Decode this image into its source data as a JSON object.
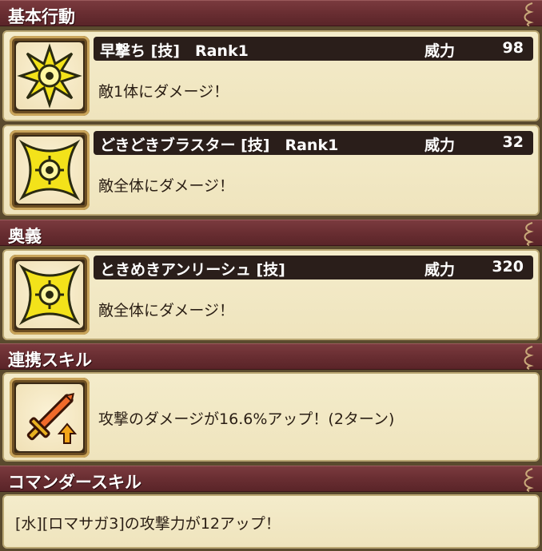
{
  "sections": {
    "basic": {
      "title": "基本行動"
    },
    "ougi": {
      "title": "奥義"
    },
    "link": {
      "title": "連携スキル"
    },
    "commander": {
      "title": "コマンダースキル"
    }
  },
  "skills": [
    {
      "name": "早撃ち [技]　Rank1",
      "power_label": "威力",
      "power": "98",
      "description": "敵1体にダメージ！",
      "icon": "starburst-icon"
    },
    {
      "name": "どきどきブラスター [技]　Rank1",
      "power_label": "威力",
      "power": "32",
      "description": "敵全体にダメージ！",
      "icon": "shuriken-icon"
    },
    {
      "name": "ときめきアンリーシュ [技]",
      "power_label": "威力",
      "power": "320",
      "description": "敵全体にダメージ！",
      "icon": "shuriken-icon"
    }
  ],
  "link_skill": {
    "description": "攻撃のダメージが16.6%アップ！(2ターン)",
    "icon": "sword-up-icon"
  },
  "commander_skill": {
    "description": "[水][ロマサガ3]の攻撃力が12アップ！"
  },
  "colors": {
    "header_bg": "#6b2f33",
    "card_bg": "#f2e8c4",
    "title_bar": "#2a1e1a",
    "icon_yellow": "#f3e21a"
  }
}
